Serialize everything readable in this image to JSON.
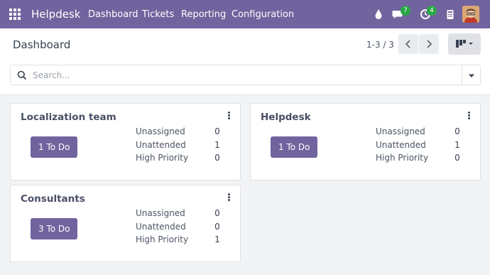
{
  "navbar": {
    "brand": "Helpdesk",
    "menu": [
      "Dashboard",
      "Tickets",
      "Reporting",
      "Configuration"
    ],
    "messages_count": "7",
    "activities_count": "4"
  },
  "control": {
    "title": "Dashboard",
    "pager": "1-3 / 3",
    "search_placeholder": "Search..."
  },
  "teams": [
    {
      "name": "Localization team",
      "todo": "1 To Do",
      "stats": [
        {
          "label": "Unassigned",
          "value": "0"
        },
        {
          "label": "Unattended",
          "value": "1"
        },
        {
          "label": "High Priority",
          "value": "0"
        }
      ]
    },
    {
      "name": "Helpdesk",
      "todo": "1 To Do",
      "stats": [
        {
          "label": "Unassigned",
          "value": "0"
        },
        {
          "label": "Unattended",
          "value": "1"
        },
        {
          "label": "High Priority",
          "value": "0"
        }
      ]
    },
    {
      "name": "Consultants",
      "todo": "3 To Do",
      "stats": [
        {
          "label": "Unassigned",
          "value": "0"
        },
        {
          "label": "Unattended",
          "value": "0"
        },
        {
          "label": "High Priority",
          "value": "1"
        }
      ]
    }
  ],
  "colors": {
    "brand": "#71639e",
    "badge": "#28a745"
  }
}
